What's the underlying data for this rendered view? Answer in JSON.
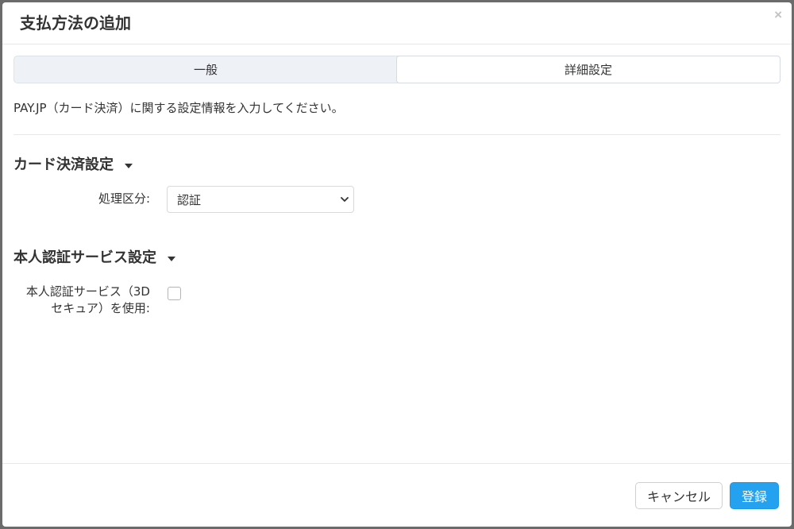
{
  "dialog": {
    "title": "支払方法の追加",
    "close_symbol": "×"
  },
  "tabs": [
    {
      "label": "一般",
      "active": false
    },
    {
      "label": "詳細設定",
      "active": true
    }
  ],
  "description": "PAY.JP（カード決済）に関する設定情報を入力してください。",
  "card_section": {
    "heading": "カード決済設定",
    "processing_type": {
      "label": "処理区分:",
      "value": "認証"
    }
  },
  "auth_section": {
    "heading": "本人認証サービス設定",
    "use_3d_secure": {
      "label_line1": "本人認証サービス（3D",
      "label_line2": "セキュア）を使用:",
      "checked": false
    }
  },
  "footer": {
    "cancel_label": "キャンセル",
    "submit_label": "登録"
  },
  "colors": {
    "primary": "#24a2f0",
    "overlay": "#6b6b6b"
  }
}
